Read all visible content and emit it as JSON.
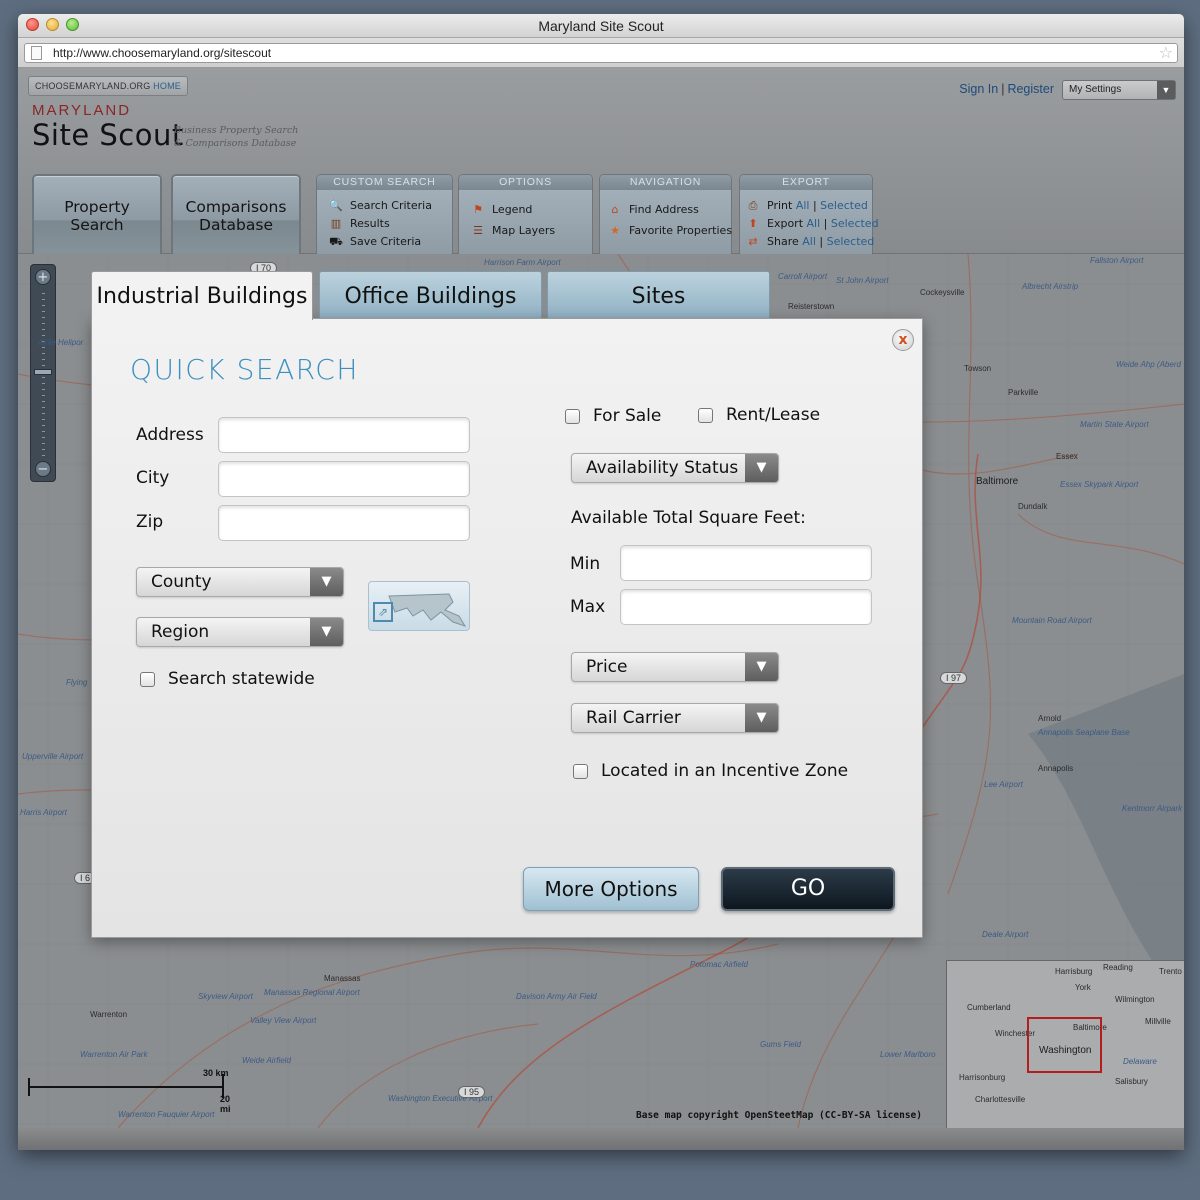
{
  "window": {
    "title": "Maryland Site Scout",
    "url": "http://www.choosemaryland.org/sitescout"
  },
  "header": {
    "home_link_a": "CHOOSEMARYLAND.ORG",
    "home_link_b": "HOME",
    "brand_top": "MARYLAND",
    "brand_main": "Site Scout",
    "brand_sub_1": "Business Property Search",
    "brand_sub_2": "& Comparisons Database",
    "sign_in": "Sign In",
    "sep": "|",
    "register": "Register",
    "settings": "My Settings",
    "big_buttons": [
      {
        "line1": "Property",
        "line2": "Search"
      },
      {
        "line1": "Comparisons",
        "line2": "Database"
      }
    ],
    "custom_search": {
      "title": "CUSTOM SEARCH",
      "items": [
        "Search Criteria",
        "Results",
        "Save Criteria"
      ]
    },
    "options": {
      "title": "OPTIONS",
      "items": [
        "Legend",
        "Map Layers"
      ]
    },
    "navigation": {
      "title": "NAVIGATION",
      "items": [
        "Find Address",
        "Favorite Properties"
      ]
    },
    "export": {
      "title": "EXPORT",
      "items": [
        {
          "label": "Print",
          "all": "All",
          "sep": "|",
          "selected": "Selected"
        },
        {
          "label": "Export",
          "all": "All",
          "sep": "|",
          "selected": "Selected"
        },
        {
          "label": "Share",
          "all": "All",
          "sep": "|",
          "selected": "Selected"
        }
      ]
    }
  },
  "zoom": {
    "plus": "+",
    "minus": "−"
  },
  "tabs": [
    "Industrial Buildings",
    "Office Buildings",
    "Sites"
  ],
  "search": {
    "title": "QUICK SEARCH",
    "address_label": "Address",
    "city_label": "City",
    "zip_label": "Zip",
    "address_value": "",
    "city_value": "",
    "zip_value": "",
    "county": "County",
    "region": "Region",
    "statewide": "Search statewide",
    "for_sale": "For Sale",
    "rent_lease": "Rent/Lease",
    "availability": "Availability Status",
    "sqft_label": "Available Total Square Feet:",
    "min_label": "Min",
    "max_label": "Max",
    "min_value": "",
    "max_value": "",
    "price": "Price",
    "rail": "Rail Carrier",
    "incentive": "Located in an Incentive Zone",
    "more_options": "More Options",
    "go": "GO",
    "close": "x"
  },
  "map": {
    "labels": [
      {
        "text": "Harrison Farm Airport",
        "kind": "airport"
      },
      {
        "text": "Carroll Airport",
        "kind": "airport"
      },
      {
        "text": "St John Airport",
        "kind": "airport"
      },
      {
        "text": "Reisterstown",
        "kind": "town"
      },
      {
        "text": "Cockeysville",
        "kind": "town"
      },
      {
        "text": "Albrecht Airstrip",
        "kind": "airport"
      },
      {
        "text": "Fallston Airport",
        "kind": "airport"
      },
      {
        "text": "Towson",
        "kind": "town"
      },
      {
        "text": "Parkville",
        "kind": "town"
      },
      {
        "text": "Weide Ahp (Aberd",
        "kind": "airport"
      },
      {
        "text": "Martin State Airport",
        "kind": "airport"
      },
      {
        "text": "Essex",
        "kind": "town"
      },
      {
        "text": "Baltimore",
        "kind": "city"
      },
      {
        "text": "Essex Skypark Airport",
        "kind": "airport"
      },
      {
        "text": "Dundalk",
        "kind": "town"
      },
      {
        "text": "Mountain Road Airport",
        "kind": "airport"
      },
      {
        "text": "Arnold",
        "kind": "town"
      },
      {
        "text": "Annapolis Seaplane Base",
        "kind": "airport"
      },
      {
        "text": "Annapolis",
        "kind": "town"
      },
      {
        "text": "Lee Airport",
        "kind": "airport"
      },
      {
        "text": "Kentmorr Airpark",
        "kind": "airport"
      },
      {
        "text": "Deale Airport",
        "kind": "airport"
      },
      {
        "text": "Warrenton",
        "kind": "town"
      },
      {
        "text": "Manassas",
        "kind": "town"
      },
      {
        "text": "Warrenton Air Park",
        "kind": "airport"
      },
      {
        "text": "Skyview Airport",
        "kind": "airport"
      },
      {
        "text": "Manassas Regional Airport",
        "kind": "airport"
      },
      {
        "text": "Valley View Airport",
        "kind": "airport"
      },
      {
        "text": "Upperville Airport",
        "kind": "airport"
      },
      {
        "text": "Harris Airport",
        "kind": "airport"
      },
      {
        "text": "Flying",
        "kind": "airport"
      },
      {
        "text": "Airlie Helipor",
        "kind": "airport"
      },
      {
        "text": "Warrenton Fauquier Airport",
        "kind": "airport"
      },
      {
        "text": "Washington Executive Airport",
        "kind": "airport"
      },
      {
        "text": "Davison Army Air Field",
        "kind": "airport"
      },
      {
        "text": "Potomac Airfield",
        "kind": "airport"
      },
      {
        "text": "Lower Marlboro",
        "kind": "airport"
      },
      {
        "text": "Gums Field",
        "kind": "airport"
      },
      {
        "text": "Weide Airfield",
        "kind": "airport"
      }
    ],
    "shields": [
      "I 70",
      "I 97",
      "I 95",
      "I 6"
    ],
    "minimap_labels": [
      "Harrisburg",
      "Reading",
      "Trento",
      "York",
      "Wilmington",
      "Cumberland",
      "Baltimore",
      "Millville",
      "Winchester",
      "Washington",
      "Delaware",
      "Harrisonburg",
      "Salisbury",
      "Charlottesville"
    ],
    "scale_km": "30 km",
    "scale_mi": "20 mi",
    "credit": "Base map copyright OpenSteetMap  (CC-BY-SA license)"
  },
  "colors": {
    "accent": "#3d8fbf",
    "brand_red": "#8b2626",
    "go_button": "#0d1720"
  }
}
